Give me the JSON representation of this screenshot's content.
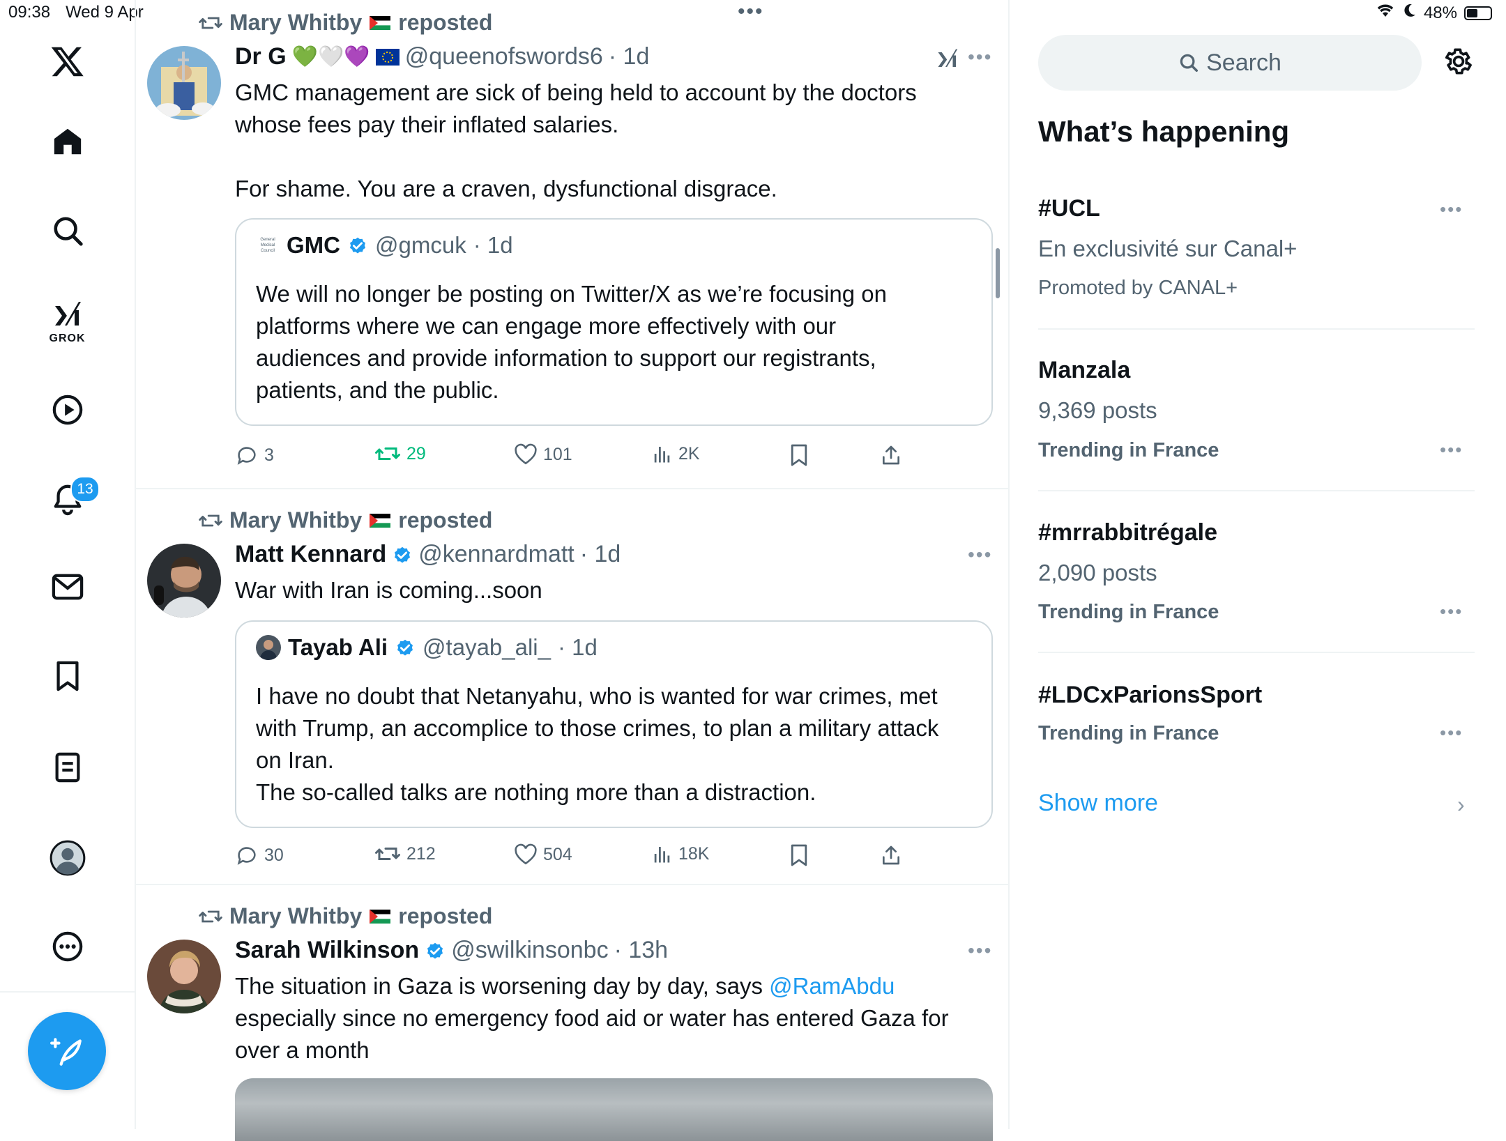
{
  "status_bar": {
    "time": "09:38",
    "date": "Wed 9 Apr",
    "battery": "48%",
    "battery_level": 0.48
  },
  "nav": {
    "grok_label": "GROK",
    "notifications_count": "13"
  },
  "feed": {
    "tweets": [
      {
        "repost_by": "Mary Whitby",
        "repost_label": "reposted",
        "author": "Dr G",
        "author_emojis": "💚🤍💜",
        "handle": "@queenofswords6",
        "time": "· 1d",
        "text": "GMC management are sick of being held to account by the doctors\nwhose fees pay their inflated salaries.\n\nFor shame. You are a craven, dysfunctional disgrace.",
        "quote": {
          "author": "GMC",
          "handle": "@gmcuk",
          "time": "· 1d",
          "logo_text": "General Medical Council",
          "text": "We will no longer be posting on Twitter/X as we’re focusing on\nplatforms where we can engage more effectively with our\naudiences and provide information to support our registrants,\npatients, and the public."
        },
        "stats": {
          "replies": "3",
          "reposts": "29",
          "likes": "101",
          "views": "2K"
        }
      },
      {
        "repost_by": "Mary Whitby",
        "repost_label": "reposted",
        "author": "Matt Kennard",
        "handle": "@kennardmatt",
        "time": "· 1d",
        "text": "War with Iran is coming...soon",
        "quote": {
          "author": "Tayab Ali",
          "handle": "@tayab_ali_",
          "time": "· 1d",
          "text": "I have no doubt that Netanyahu, who is wanted for war crimes, met\nwith Trump, an accomplice to those crimes, to plan a military attack\non Iran.\nThe so-called talks are nothing more than a distraction."
        },
        "stats": {
          "replies": "30",
          "reposts": "212",
          "likes": "504",
          "views": "18K"
        }
      },
      {
        "repost_by": "Mary Whitby",
        "repost_label": "reposted",
        "author": "Sarah Wilkinson",
        "handle": "@swilkinsonbc",
        "time": "· 13h",
        "text_before_mention": "The situation in Gaza is worsening day by day, says ",
        "mention": "@RamAbdu",
        "text_after_mention": "\nespecially since no emergency food aid or water has entered Gaza for\nover a month"
      }
    ]
  },
  "sidebar": {
    "search_placeholder": "Search",
    "heading": "What’s happening",
    "trends": [
      {
        "title": "#UCL",
        "sub": "En exclusivité sur Canal+",
        "meta": "Promoted by CANAL+"
      },
      {
        "title": "Manzala",
        "sub": "9,369 posts",
        "meta": "Trending in France"
      },
      {
        "title": "#mrrabbitrégale",
        "sub": "2,090 posts",
        "meta": "Trending in France"
      },
      {
        "title": "#LDCxParionsSport",
        "meta": "Trending in France"
      }
    ],
    "show_more": "Show more"
  },
  "colors": {
    "accent": "#1d9bf0",
    "repost_green": "#00ba7c",
    "text": "#0f1419",
    "muted": "#536471"
  }
}
